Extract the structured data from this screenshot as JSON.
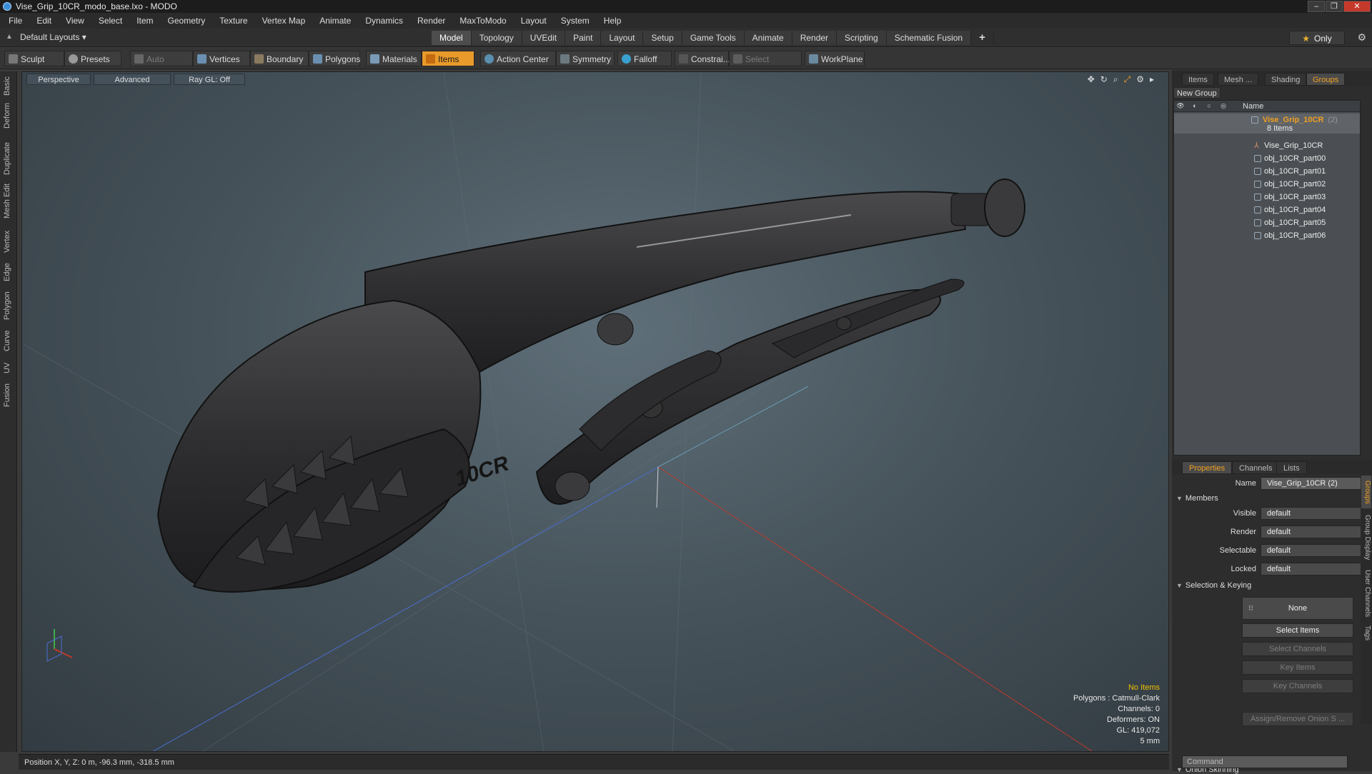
{
  "window": {
    "title": "Vise_Grip_10CR_modo_base.lxo - MODO"
  },
  "menu": [
    "File",
    "Edit",
    "View",
    "Select",
    "Item",
    "Geometry",
    "Texture",
    "Vertex Map",
    "Animate",
    "Dynamics",
    "Render",
    "MaxToModo",
    "Layout",
    "System",
    "Help"
  ],
  "layout": {
    "default_layouts": "Default Layouts ▾",
    "tabs": [
      "Model",
      "Topology",
      "UVEdit",
      "Paint",
      "Layout",
      "Setup",
      "Game Tools",
      "Animate",
      "Render",
      "Scripting",
      "Schematic Fusion"
    ],
    "active_tab": "Model",
    "only_label": "Only"
  },
  "toolbar": {
    "sculpt": "Sculpt",
    "presets": "Presets",
    "auto_select": "Auto Select",
    "vertices": "Vertices",
    "boundary": "Boundary",
    "polygons": "Polygons",
    "materials": "Materials",
    "items": "Items",
    "action_center": "Action Center",
    "symmetry": "Symmetry",
    "falloff": "Falloff",
    "constrain": "Constrai...",
    "select_through": "Select Through",
    "workplane": "WorkPlane"
  },
  "viewport": {
    "perspective": "Perspective",
    "advanced": "Advanced",
    "raygl": "Ray GL: Off",
    "info": {
      "no_items": "No Items",
      "polygons": "Polygons : Catmull-Clark",
      "channels": "Channels: 0",
      "deformers": "Deformers: ON",
      "gl": "GL: 419,072",
      "scale": "5 mm"
    },
    "model_label": "10CR"
  },
  "left_tabs": [
    "Basic",
    "Deform",
    "Duplicate",
    "Mesh Edit",
    "Vertex",
    "Edge",
    "Polygon",
    "Curve",
    "UV",
    "Fusion"
  ],
  "status": {
    "position": "Position X, Y, Z:  0 m, -96.3 mm, -318.5 mm"
  },
  "groups_panel": {
    "tabs": [
      "Items",
      "Mesh ...",
      "Shading",
      "Groups"
    ],
    "active_tab": "Groups",
    "new_group": "New Group",
    "column_name": "Name",
    "group_name": "Vise_Grip_10CR",
    "group_count": "(2)",
    "group_items": "8 Items",
    "items": [
      "Vise_Grip_10CR",
      "obj_10CR_part00",
      "obj_10CR_part01",
      "obj_10CR_part02",
      "obj_10CR_part03",
      "obj_10CR_part04",
      "obj_10CR_part05",
      "obj_10CR_part06"
    ]
  },
  "properties": {
    "tabs": [
      "Properties",
      "Channels",
      "Lists"
    ],
    "active_tab": "Properties",
    "name_label": "Name",
    "name_value": "Vise_Grip_10CR (2)",
    "members": "Members",
    "visible_label": "Visible",
    "visible": "default",
    "render_label": "Render",
    "render": "default",
    "selectable_label": "Selectable",
    "selectable": "default",
    "locked_label": "Locked",
    "locked": "default",
    "selection_keying": "Selection & Keying",
    "none_btn": "None",
    "select_items": "Select Items",
    "select_channels": "Select Channels",
    "key_items": "Key Items",
    "key_channels": "Key Channels",
    "onion": "Onion Skinning",
    "assign_onion": "Assign/Remove Onion S ...",
    "side_tabs": [
      "Groups",
      "Group Display",
      "User Channels",
      "Tags"
    ],
    "command_placeholder": "Command"
  },
  "colors": {
    "accent": "#e89a2a",
    "x_axis": "#c0392b",
    "z_axis": "#4a6fd0",
    "y_axis": "#3fae49"
  }
}
